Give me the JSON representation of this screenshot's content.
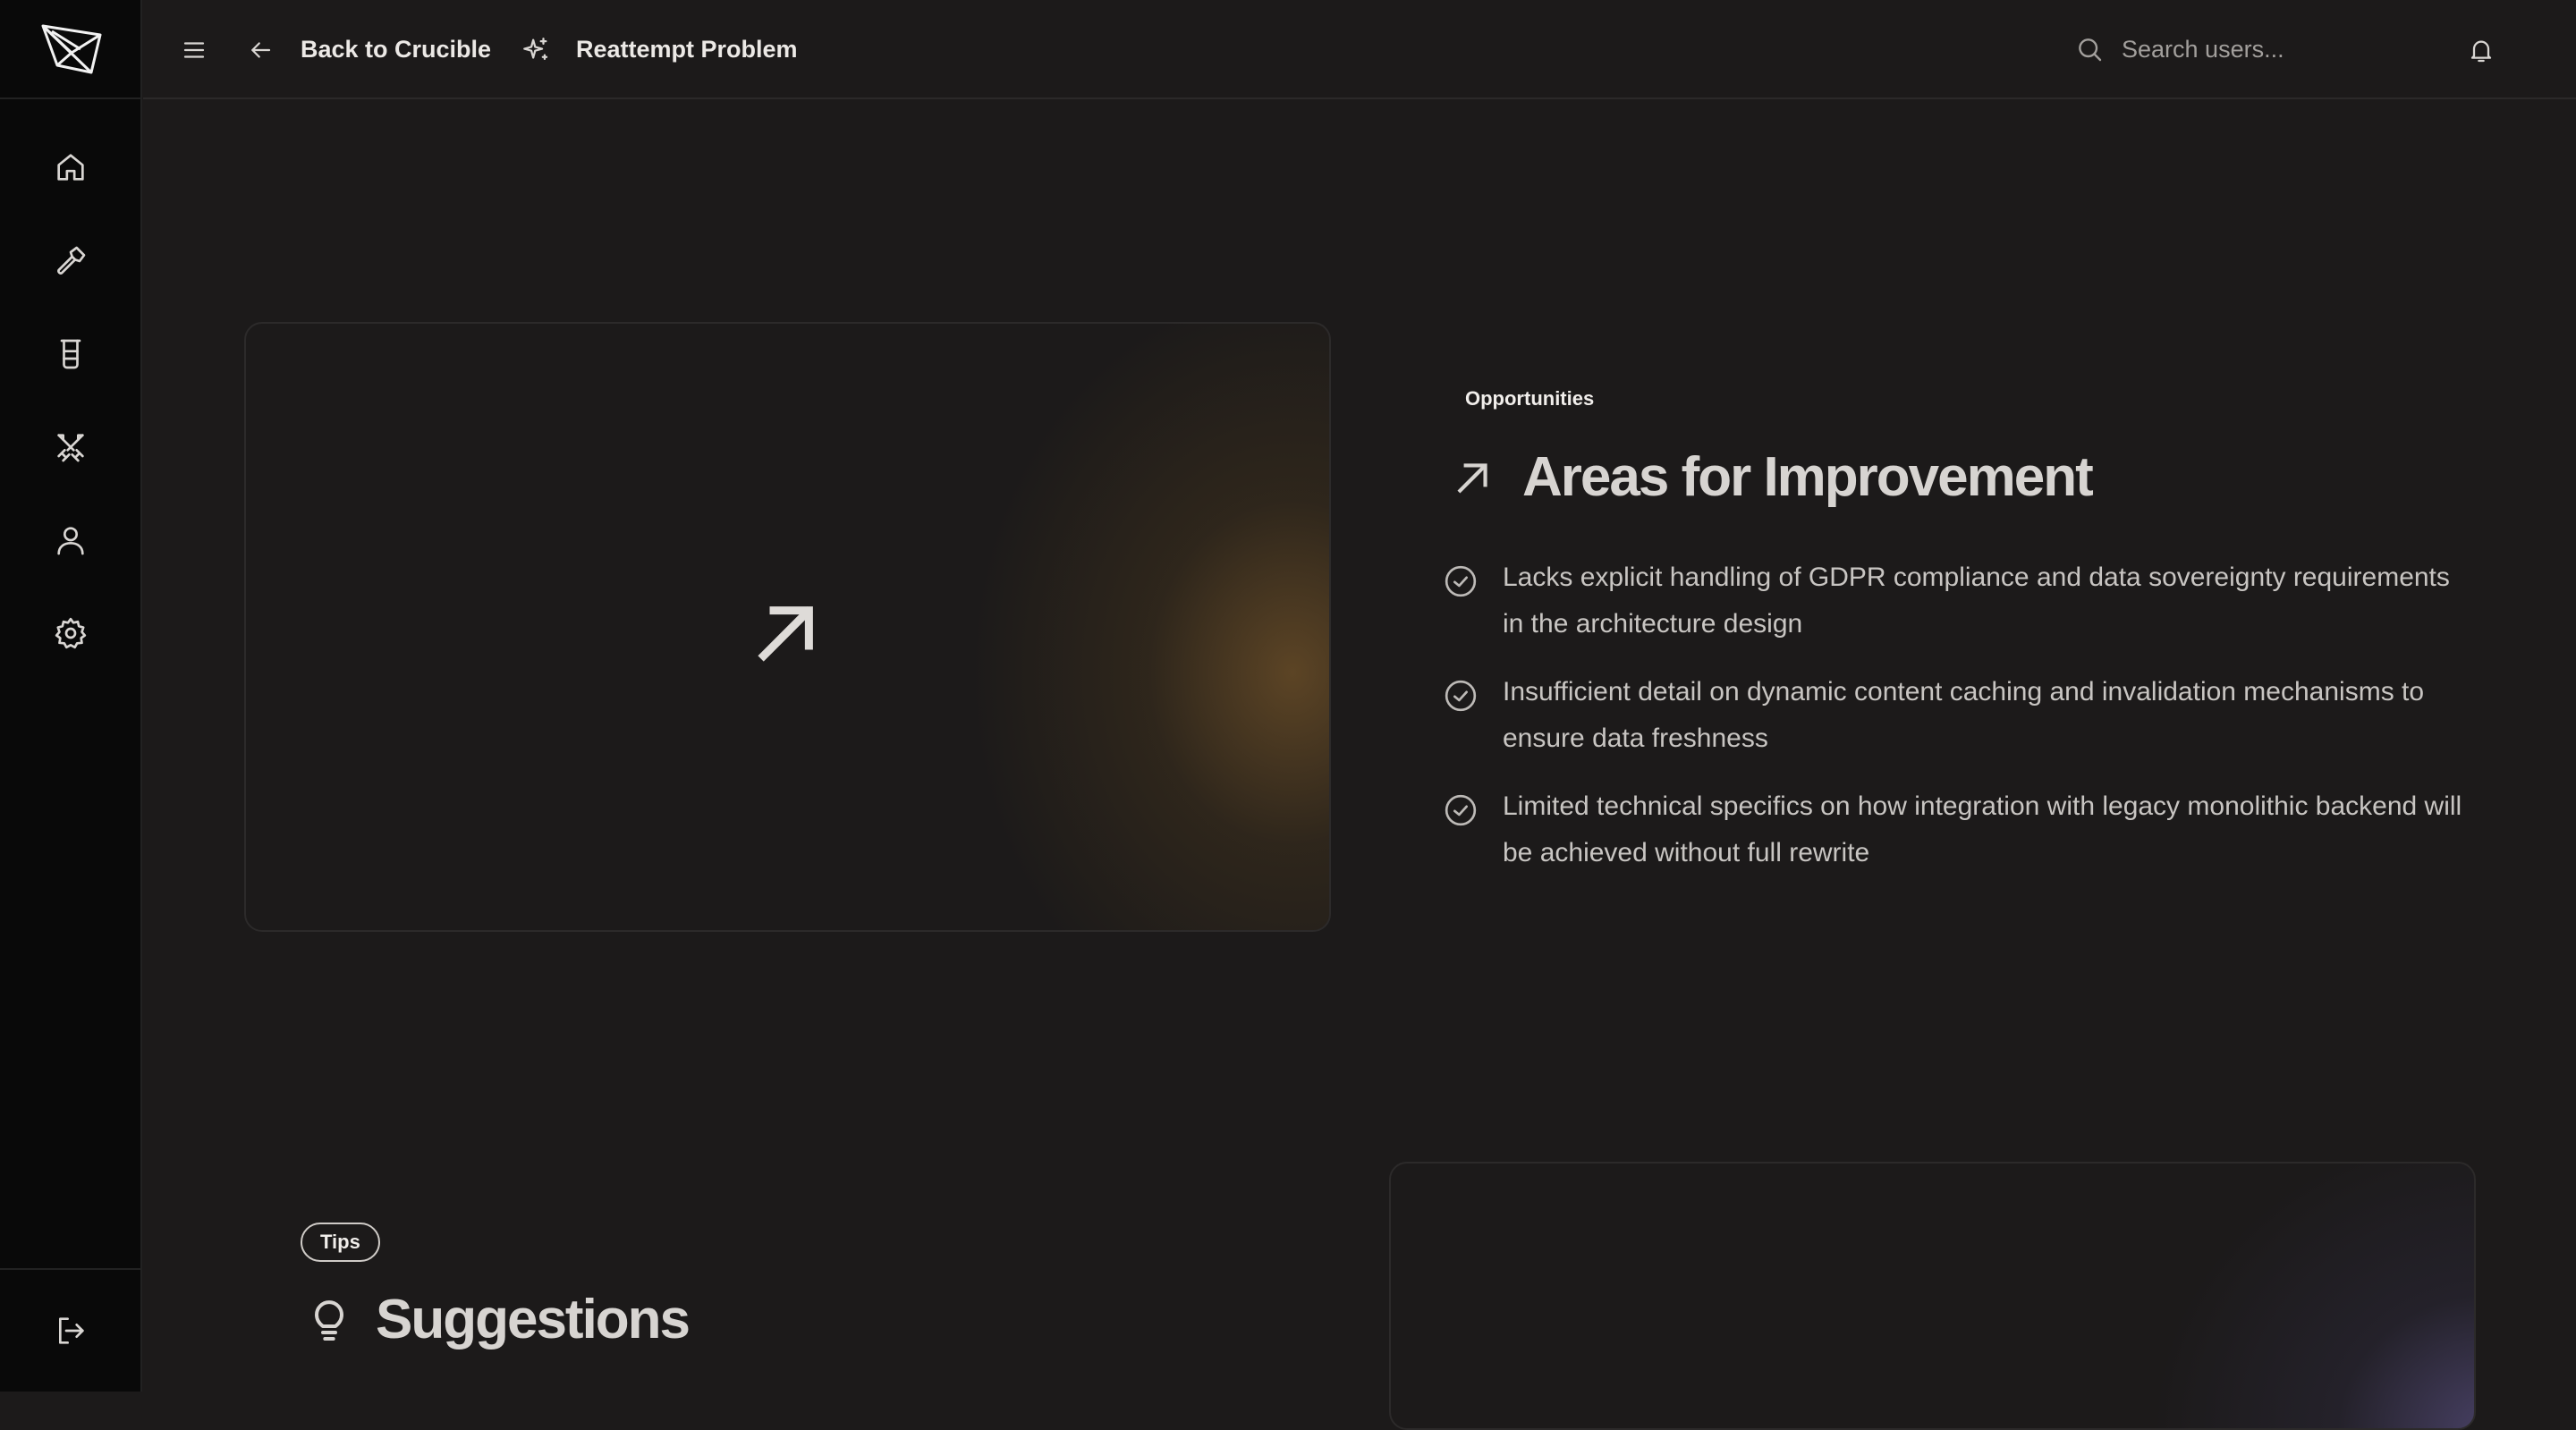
{
  "topbar": {
    "back_label": "Back to Crucible",
    "reattempt_label": "Reattempt Problem",
    "search_placeholder": "Search users..."
  },
  "sidebar": {
    "items": [
      {
        "icon": "home-icon"
      },
      {
        "icon": "hammer-icon"
      },
      {
        "icon": "beaker-icon"
      },
      {
        "icon": "swords-icon"
      },
      {
        "icon": "user-icon"
      },
      {
        "icon": "gear-icon"
      }
    ],
    "bottom_icon": "logout-icon"
  },
  "improvement": {
    "section_label": "Opportunities",
    "title": "Areas for Improvement",
    "items": [
      "Lacks explicit handling of GDPR compliance and data sovereignty requirements in the architecture design",
      "Insufficient detail on dynamic content caching and invalidation mechanisms to ensure data freshness",
      "Limited technical specifics on how integration with legacy monolithic backend will be achieved without full rewrite"
    ]
  },
  "suggestions": {
    "pill_label": "Tips",
    "title": "Suggestions"
  },
  "colors": {
    "background": "#1c1a1a",
    "sidebar": "#090909",
    "amber_glow": "#6e5028",
    "violet_glow": "#5f558c"
  }
}
